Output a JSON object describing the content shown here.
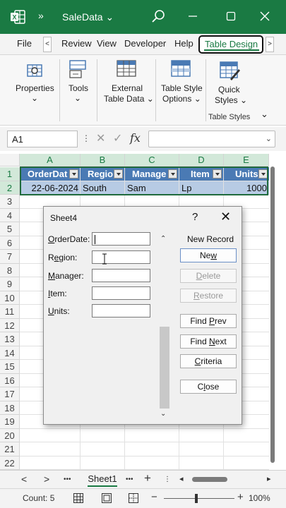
{
  "window": {
    "title": "SaleData",
    "title_chevron": "⌄",
    "overflow": "»"
  },
  "tabs": [
    {
      "label": "File"
    },
    {
      "label": "Review"
    },
    {
      "label": "View"
    },
    {
      "label": "Developer"
    },
    {
      "label": "Help"
    },
    {
      "label": "Table Design",
      "active": true
    }
  ],
  "tab_scroll": {
    "left": "<",
    "right": ">"
  },
  "ribbon": {
    "properties": {
      "label": "Properties",
      "dd": "⌄"
    },
    "tools": {
      "label": "Tools",
      "dd": "⌄"
    },
    "external": {
      "line1": "External",
      "line2": "Table Data ⌄"
    },
    "style_options": {
      "line1": "Table Style",
      "line2": "Options ⌄"
    },
    "quick_styles": {
      "line1": "Quick",
      "line2": "Styles ⌄"
    },
    "group_label": "Table Styles",
    "expand": "⌄"
  },
  "formula_bar": {
    "name_box": "A1",
    "dots": "⋮",
    "cancel": "✕",
    "enter": "✓",
    "fx": "fx",
    "value": ""
  },
  "grid": {
    "columns": [
      "A",
      "B",
      "C",
      "D",
      "E"
    ],
    "rows": [
      "1",
      "2",
      "3",
      "4",
      "5",
      "6",
      "7",
      "8",
      "9",
      "10",
      "11",
      "12",
      "13",
      "14",
      "15",
      "16",
      "17",
      "18",
      "19",
      "20",
      "21",
      "22"
    ],
    "header_row": [
      "OrderDat",
      "Regio",
      "Manage",
      "Item",
      "Units"
    ],
    "data_row": [
      "22-06-2024",
      "South",
      "Sam",
      "Lp",
      "1000"
    ]
  },
  "dialog": {
    "title": "Sheet4",
    "help": "?",
    "close": "✕",
    "fields": [
      {
        "pre": "",
        "ul": "O",
        "post": "rderDate:",
        "value": ""
      },
      {
        "pre": "R",
        "ul": "e",
        "post": "gion:",
        "value": ""
      },
      {
        "pre": "",
        "ul": "M",
        "post": "anager:",
        "value": ""
      },
      {
        "pre": "",
        "ul": "I",
        "post": "tem:",
        "value": ""
      },
      {
        "pre": "",
        "ul": "U",
        "post": "nits:",
        "value": ""
      }
    ],
    "record_info": "New Record",
    "buttons": [
      {
        "pre": "Ne",
        "ul": "w",
        "post": "",
        "disabled": false
      },
      {
        "pre": "",
        "ul": "D",
        "post": "elete",
        "disabled": true
      },
      {
        "pre": "",
        "ul": "R",
        "post": "estore",
        "disabled": true
      },
      {
        "pre": "Find ",
        "ul": "P",
        "post": "rev",
        "disabled": false
      },
      {
        "pre": "Find ",
        "ul": "N",
        "post": "ext",
        "disabled": false
      },
      {
        "pre": "",
        "ul": "C",
        "post": "riteria",
        "disabled": false
      },
      {
        "pre": "C",
        "ul": "l",
        "post": "ose",
        "disabled": false
      }
    ],
    "scroll_up": "⌃",
    "scroll_down": "⌄"
  },
  "sheetbar": {
    "prev": "<",
    "next": ">",
    "more": "•••",
    "sheet": "Sheet1",
    "more2": "•••",
    "add": "+"
  },
  "status": {
    "count": "Count: 5",
    "zoom_minus": "−",
    "zoom_plus": "+",
    "zoom": "100%"
  },
  "colors": {
    "excel_green": "#1a7a43",
    "table_header": "#4a7ab4",
    "table_row": "#b7cbe4"
  }
}
